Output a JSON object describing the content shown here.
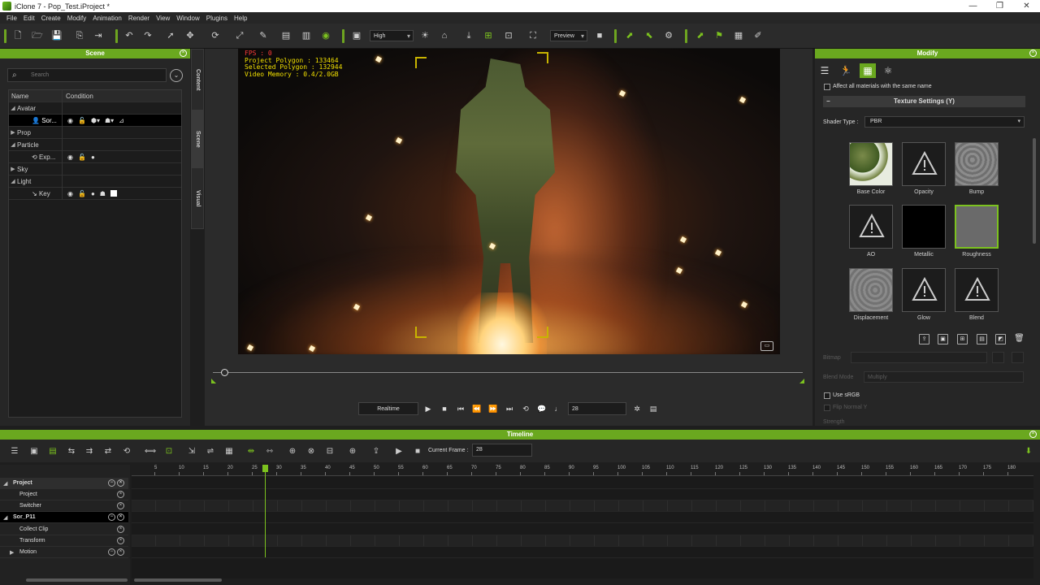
{
  "window": {
    "title": "iClone 7 - Pop_Test.iProject *",
    "minimize": "—",
    "maximize": "❐",
    "close": "✕"
  },
  "menu": [
    "File",
    "Edit",
    "Create",
    "Modify",
    "Animation",
    "Render",
    "View",
    "Window",
    "Plugins",
    "Help"
  ],
  "toolbar": {
    "quality": "High",
    "render_mode": "Preview"
  },
  "scene_panel": {
    "title": "Scene",
    "search_placeholder": "Search",
    "columns": {
      "name": "Name",
      "condition": "Condition"
    },
    "rows": [
      {
        "label": "Avatar",
        "kind": "group",
        "expanded": true
      },
      {
        "label": "Sor...",
        "kind": "item",
        "selected": true
      },
      {
        "label": "Prop",
        "kind": "group",
        "expanded": false
      },
      {
        "label": "Particle",
        "kind": "group",
        "expanded": true
      },
      {
        "label": "Exp...",
        "kind": "item"
      },
      {
        "label": "Sky",
        "kind": "group",
        "expanded": false
      },
      {
        "label": "Light",
        "kind": "group",
        "expanded": true
      },
      {
        "label": "Key",
        "kind": "item"
      }
    ]
  },
  "side_tabs": [
    "Content",
    "Scene",
    "Visual"
  ],
  "viewport": {
    "fps": "FPS : 0",
    "project_polygon": "Project Polygon : 133464",
    "selected_polygon": "Selected Polygon : 132944",
    "video_memory": "Video Memory : 0.4/2.0GB"
  },
  "playback": {
    "mode": "Realtime",
    "frame": "28"
  },
  "modify_panel": {
    "title": "Modify",
    "affect_all": "Affect all materials with the same name",
    "texture_settings": "Texture Settings  (Y)",
    "shader_type_label": "Shader Type :",
    "shader_type": "PBR",
    "slots": [
      "Base Color",
      "Opacity",
      "Bump",
      "AO",
      "Metallic",
      "Roughness",
      "Displacement",
      "Glow",
      "Blend"
    ],
    "bitmap_label": "Bitmap",
    "blend_mode_label": "Blend Mode",
    "blend_mode": "Multiply",
    "use_srgb": "Use sRGB",
    "flip_normal": "Flip Normal Y",
    "strength": "Strength"
  },
  "timeline": {
    "title": "Timeline",
    "current_frame_label": "Current Frame :",
    "current_frame": "28",
    "ruler_ticks": [
      "5",
      "10",
      "15",
      "20",
      "25",
      "30",
      "35",
      "40",
      "45",
      "50",
      "55",
      "60",
      "65",
      "70",
      "75",
      "80",
      "85",
      "90",
      "95",
      "100",
      "105",
      "110",
      "115",
      "120",
      "125",
      "130",
      "135",
      "140",
      "145",
      "150",
      "155",
      "160",
      "165",
      "170",
      "175",
      "180"
    ],
    "tracks": [
      {
        "label": "Project",
        "major": true
      },
      {
        "label": "Project",
        "major": false
      },
      {
        "label": "Switcher",
        "major": false
      },
      {
        "label": "Sor_P11",
        "major": true
      },
      {
        "label": "Collect Clip",
        "major": false
      },
      {
        "label": "Transform",
        "major": false
      },
      {
        "label": "Motion",
        "major": false
      }
    ]
  }
}
